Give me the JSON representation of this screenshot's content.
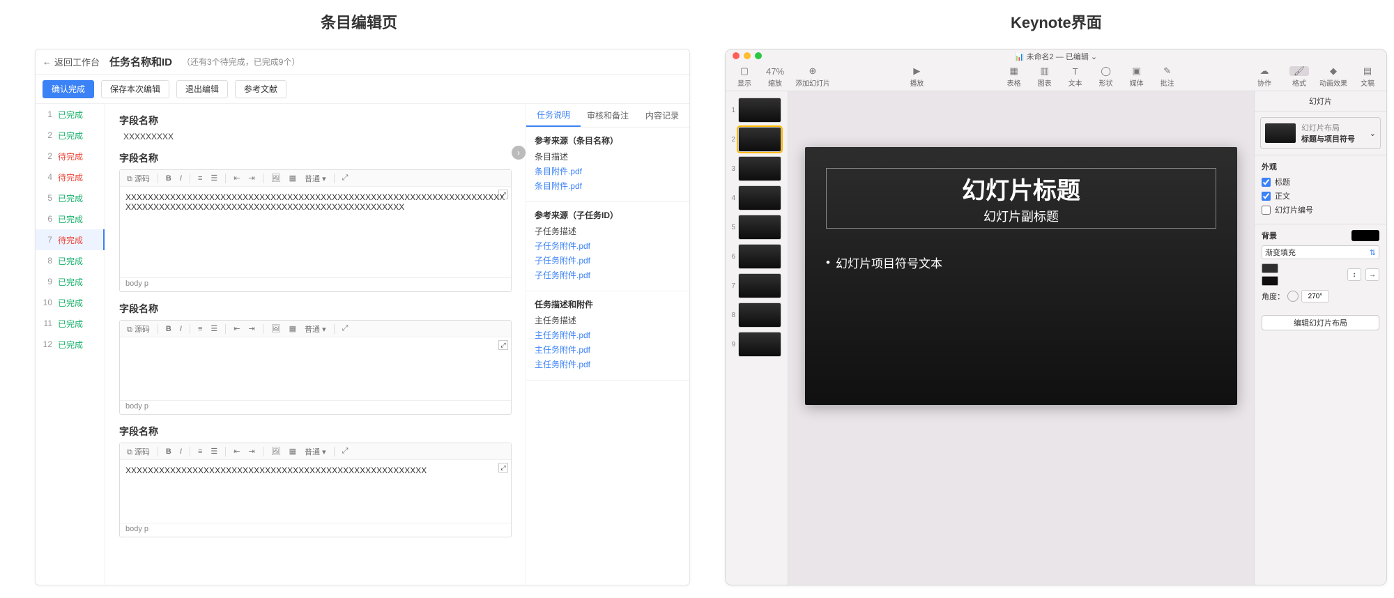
{
  "screenshot_titles": {
    "left": "条目编辑页",
    "right": "Keynote界面"
  },
  "left_app": {
    "back_label": "返回工作台",
    "task_title": "任务名称和ID",
    "task_sub": "（还有3个待完成，已完成9个）",
    "buttons": {
      "confirm": "确认完成",
      "save": "保存本次编辑",
      "exit": "退出编辑",
      "ref": "参考文献"
    },
    "sidebar_items": [
      {
        "num": "1",
        "status": "已完成",
        "kind": "done"
      },
      {
        "num": "2",
        "status": "已完成",
        "kind": "done"
      },
      {
        "num": "2",
        "status": "待完成",
        "kind": "pending"
      },
      {
        "num": "4",
        "status": "待完成",
        "kind": "pending"
      },
      {
        "num": "5",
        "status": "已完成",
        "kind": "done"
      },
      {
        "num": "6",
        "status": "已完成",
        "kind": "done"
      },
      {
        "num": "7",
        "status": "待完成",
        "kind": "pending",
        "active": true
      },
      {
        "num": "8",
        "status": "已完成",
        "kind": "done"
      },
      {
        "num": "9",
        "status": "已完成",
        "kind": "done"
      },
      {
        "num": "10",
        "status": "已完成",
        "kind": "done"
      },
      {
        "num": "11",
        "status": "已完成",
        "kind": "done"
      },
      {
        "num": "12",
        "status": "已完成",
        "kind": "done"
      }
    ],
    "fields": [
      {
        "title": "字段名称",
        "value": "XXXXXXXXX"
      },
      {
        "title": "字段名称",
        "body": "XXXXXXXXXXXXXXXXXXXXXXXXXXXXXXXXXXXXXXXXXXXXXXXXXXXXXXXXXXXXXXXXXXXXXXXXXXXXXXXXXXXXXXXXXXXXXXXXXXXXXXXXXXXXXXXXXXXXXX",
        "footer": "body  p"
      },
      {
        "title": "字段名称",
        "body": "",
        "footer": "body  p"
      },
      {
        "title": "字段名称",
        "body": "XXXXXXXXXXXXXXXXXXXXXXXXXXXXXXXXXXXXXXXXXXXXXXXXXXXXXX",
        "footer": "body  p"
      }
    ],
    "rte_tools": {
      "source": "源码",
      "normal": "普通",
      "expand_icon": "⤢"
    },
    "right_panel": {
      "tabs": [
        "任务说明",
        "审核和备注",
        "内容记录"
      ],
      "active_tab": 0,
      "sections": [
        {
          "title": "参考来源（条目名称）",
          "lines": [
            "条目描述"
          ],
          "links": [
            "条目附件.pdf",
            "条目附件.pdf"
          ]
        },
        {
          "title": "参考来源（子任务ID）",
          "lines": [
            "子任务描述"
          ],
          "links": [
            "子任务附件.pdf",
            "子任务附件.pdf",
            "子任务附件.pdf"
          ]
        },
        {
          "title": "任务描述和附件",
          "lines": [
            "主任务描述"
          ],
          "links": [
            "主任务附件.pdf",
            "主任务附件.pdf",
            "主任务附件.pdf"
          ]
        }
      ]
    }
  },
  "keynote": {
    "window_title": "未命名2 — 已编辑",
    "zoom_label": "47%",
    "toolbar_left": [
      {
        "name": "view",
        "label": "显示",
        "glyph": "▢"
      },
      {
        "name": "zoom",
        "label": "缩放",
        "glyph": "47%"
      },
      {
        "name": "add-slide",
        "label": "添加幻灯片",
        "glyph": "⊕"
      }
    ],
    "toolbar_center": [
      {
        "name": "play",
        "label": "播放",
        "glyph": "▶"
      }
    ],
    "toolbar_insert": [
      {
        "name": "table",
        "label": "表格",
        "glyph": "▦"
      },
      {
        "name": "chart",
        "label": "图表",
        "glyph": "▥"
      },
      {
        "name": "text",
        "label": "文本",
        "glyph": "T"
      },
      {
        "name": "shape",
        "label": "形状",
        "glyph": "◯"
      },
      {
        "name": "media",
        "label": "媒体",
        "glyph": "▣"
      },
      {
        "name": "comment",
        "label": "批注",
        "glyph": "✎"
      }
    ],
    "toolbar_right": [
      {
        "name": "collab",
        "label": "协作",
        "glyph": "☁"
      },
      {
        "name": "format",
        "label": "格式",
        "glyph": "🖌",
        "active": true
      },
      {
        "name": "animate",
        "label": "动画效果",
        "glyph": "◆"
      },
      {
        "name": "document",
        "label": "文稿",
        "glyph": "▤"
      }
    ],
    "thumbs": [
      1,
      2,
      3,
      4,
      5,
      6,
      7,
      8,
      9
    ],
    "active_thumb": 2,
    "slide": {
      "title": "幻灯片标题",
      "subtitle": "幻灯片副标题",
      "bullet": "幻灯片项目符号文本"
    },
    "inspector": {
      "tabs": [
        "格式",
        "动画效果",
        "文稿"
      ],
      "panel_title": "幻灯片",
      "layout_label": "幻灯片布局",
      "layout_name": "标题与项目符号",
      "appearance_label": "外观",
      "checks": [
        {
          "label": "标题",
          "checked": true
        },
        {
          "label": "正文",
          "checked": true
        },
        {
          "label": "幻灯片编号",
          "checked": false
        }
      ],
      "background_label": "背景",
      "fill_type": "渐变填充",
      "swatches": [
        "#2e2e2e",
        "#0f0f0f"
      ],
      "angle_label": "角度：",
      "angle_value": "270°",
      "edit_layout_btn": "编辑幻灯片布局"
    }
  }
}
